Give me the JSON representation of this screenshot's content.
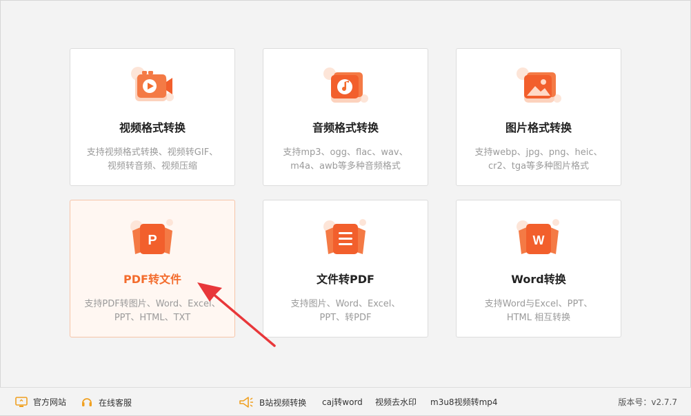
{
  "cards": [
    {
      "title": "视频格式转换",
      "desc1": "支持视频格式转换、视频转GIF、",
      "desc2": "视频转音频、视频压缩",
      "icon": "video-camera-icon"
    },
    {
      "title": "音频格式转换",
      "desc1": "支持mp3、ogg、flac、wav、",
      "desc2": "m4a、awb等多种音频格式",
      "icon": "music-note-icon"
    },
    {
      "title": "图片格式转换",
      "desc1": "支持webp、jpg、png、heic、",
      "desc2": "cr2、tga等多种图片格式",
      "icon": "image-icon"
    },
    {
      "title": "PDF转文件",
      "desc1": "支持PDF转图片、Word、Excel、",
      "desc2": "PPT、HTML、TXT",
      "icon": "pdf-p-icon"
    },
    {
      "title": "文件转PDF",
      "desc1": "支持图片、Word、Excel、",
      "desc2": "PPT、转PDF",
      "icon": "document-icon"
    },
    {
      "title": "Word转换",
      "desc1": "支持Word与Excel、PPT、",
      "desc2": "HTML 相互转换",
      "icon": "word-w-icon"
    }
  ],
  "footer": {
    "official_site": "官方网站",
    "online_support": "在线客服",
    "links": [
      "B站视频转换",
      "caj转word",
      "视频去水印",
      "m3u8视频转mp4"
    ],
    "version": "版本号：v2.7.7"
  },
  "colors": {
    "accent": "#f36c2d",
    "icon_light": "#fdd5c2",
    "icon_dark": "#f2683a"
  }
}
